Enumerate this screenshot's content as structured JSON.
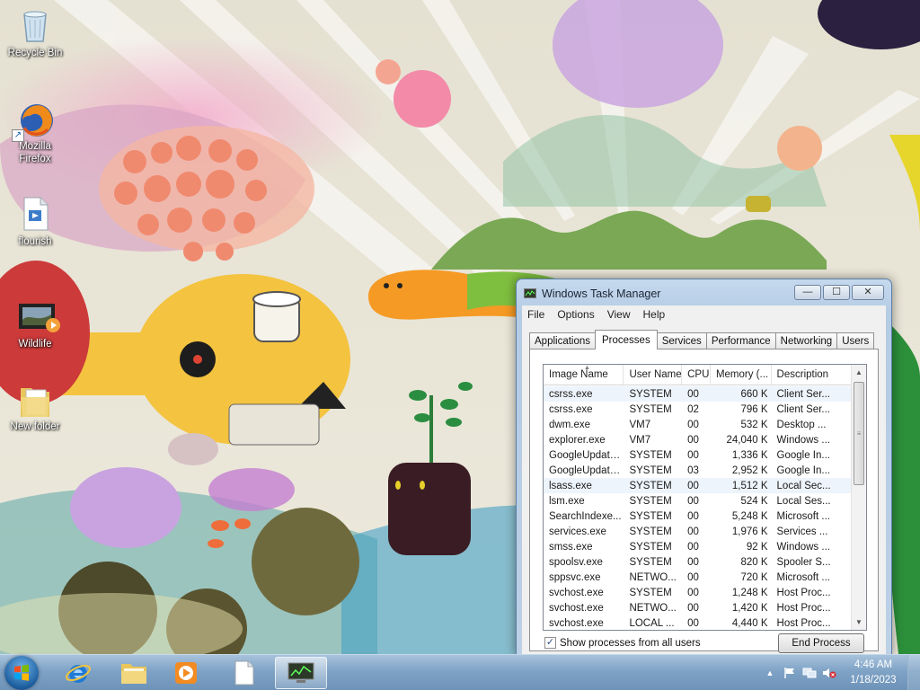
{
  "desktop": {
    "icons": [
      {
        "label": "Recycle Bin",
        "icon": "recycle-bin-icon"
      },
      {
        "label": "Mozilla Firefox",
        "icon": "firefox-icon"
      },
      {
        "label": "flourish",
        "icon": "video-file-icon"
      },
      {
        "label": "Wildlife",
        "icon": "movie-icon"
      },
      {
        "label": "New folder",
        "icon": "folder-icon"
      }
    ]
  },
  "taskmgr": {
    "title": "Windows Task Manager",
    "caption_min": "—",
    "caption_max": "☐",
    "caption_close": "✕",
    "menu": [
      "File",
      "Options",
      "View",
      "Help"
    ],
    "tabs": [
      "Applications",
      "Processes",
      "Services",
      "Performance",
      "Networking",
      "Users"
    ],
    "active_tab": "Processes",
    "columns": [
      "Image Name",
      "User Name",
      "CPU",
      "Memory (...",
      "Description"
    ],
    "rows": [
      [
        "csrss.exe",
        "SYSTEM",
        "00",
        "660 K",
        "Client Ser..."
      ],
      [
        "csrss.exe",
        "SYSTEM",
        "02",
        "796 K",
        "Client Ser..."
      ],
      [
        "dwm.exe",
        "VM7",
        "00",
        "532 K",
        "Desktop ..."
      ],
      [
        "explorer.exe",
        "VM7",
        "00",
        "24,040 K",
        "Windows ..."
      ],
      [
        "GoogleUpdate...",
        "SYSTEM",
        "00",
        "1,336 K",
        "Google In..."
      ],
      [
        "GoogleUpdate...",
        "SYSTEM",
        "03",
        "2,952 K",
        "Google In..."
      ],
      [
        "lsass.exe",
        "SYSTEM",
        "00",
        "1,512 K",
        "Local Sec..."
      ],
      [
        "lsm.exe",
        "SYSTEM",
        "00",
        "524 K",
        "Local Ses..."
      ],
      [
        "SearchIndexe...",
        "SYSTEM",
        "00",
        "5,248 K",
        "Microsoft ..."
      ],
      [
        "services.exe",
        "SYSTEM",
        "00",
        "1,976 K",
        "Services ..."
      ],
      [
        "smss.exe",
        "SYSTEM",
        "00",
        "92 K",
        "Windows ..."
      ],
      [
        "spoolsv.exe",
        "SYSTEM",
        "00",
        "820 K",
        "Spooler S..."
      ],
      [
        "sppsvc.exe",
        "NETWO...",
        "00",
        "720 K",
        "Microsoft ..."
      ],
      [
        "svchost.exe",
        "SYSTEM",
        "00",
        "1,248 K",
        "Host Proc..."
      ],
      [
        "svchost.exe",
        "NETWO...",
        "00",
        "1,420 K",
        "Host Proc..."
      ],
      [
        "svchost.exe",
        "LOCAL ...",
        "00",
        "4,440 K",
        "Host Proc..."
      ]
    ],
    "show_all_label": "Show processes from all users",
    "show_all_checked": "✓",
    "end_process_label": "End Process"
  },
  "taskbar": {
    "pinned": [
      "internet-explorer-icon",
      "folder-icon",
      "media-player-icon",
      "document-icon",
      "task-manager-icon"
    ],
    "clock_time": "4:46 AM",
    "clock_date": "1/18/2023",
    "tray_chevron": "▲"
  },
  "colors": {
    "taskbar": "#7fa3c6",
    "window_frame": "#b4cbe4",
    "selection": "#eef4fb"
  }
}
